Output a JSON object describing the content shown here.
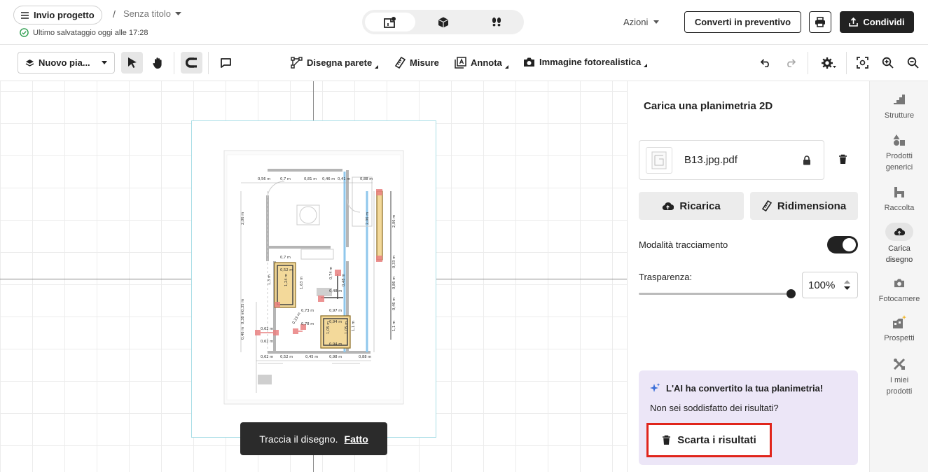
{
  "header": {
    "submit_label": "Invio progetto",
    "separator": "/",
    "project_title": "Senza titolo",
    "save_status": "Ultimo salvataggio oggi alle 17:28",
    "actions_label": "Azioni",
    "convert_label": "Converti in preventivo",
    "share_label": "Condividi"
  },
  "toolbar": {
    "level_label": "Nuovo pia...",
    "draw_wall": "Disegna parete",
    "measures": "Misure",
    "annotate": "Annota",
    "photo_image": "Immagine fotorealistica"
  },
  "canvas": {
    "toast_text": "Traccia il disegno.",
    "toast_done": "Fatto"
  },
  "panel": {
    "title": "Carica una planimetria 2D",
    "file_name": "B13.jpg.pdf",
    "reload_label": "Ricarica",
    "resize_label": "Ridimensiona",
    "tracing_label": "Modalità tracciamento",
    "tracing_on": true,
    "transparency_label": "Trasparenza:",
    "transparency_value": "100%",
    "ai_title": "L'AI ha convertito la tua planimetria!",
    "ai_question": "Non sei soddisfatto dei risultati?",
    "discard_label": "Scarta i risultati"
  },
  "rail": {
    "items": [
      {
        "label": "Strutture",
        "icon": "stairs-icon"
      },
      {
        "label": "Prodotti generici",
        "icon": "shapes-icon"
      },
      {
        "label": "Raccolta",
        "icon": "collection-icon"
      },
      {
        "label": "Carica disegno",
        "icon": "cloud-upload-icon"
      },
      {
        "label": "Fotocamere",
        "icon": "camera-icon"
      },
      {
        "label": "Prospetti",
        "icon": "elevation-icon"
      },
      {
        "label": "I miei prodotti",
        "icon": "tools-icon"
      }
    ]
  },
  "plan": {
    "dimensions": [
      "0,56 m",
      "0,7 m",
      "0,81 m",
      "0,46 m",
      "0,41 m",
      "0,88 m",
      "2,06 m",
      "2,06 m",
      "2,06 m",
      "0,7 m",
      "0,52 m",
      "1,3 m",
      "1,24 m",
      "1,63 m",
      "0,48 m",
      "0,74 m",
      "0,48 m",
      "0,73 m",
      "0,97 m",
      "0,62 m",
      "0,78 m",
      "0,33 m",
      "0,94 m",
      "1,05 m",
      "1,05 m",
      "0,94 m",
      "0,62 m",
      "0,62 m",
      "0,52 m",
      "0,45 m",
      "0,98 m",
      "0,88 m",
      "0,33 m",
      "0,86 m",
      "0,46 m",
      "1,1 m",
      "1,1 m",
      "0,35 m",
      "0,38 m",
      "0,46 m"
    ]
  },
  "colors": {
    "accent_dark": "#222222",
    "highlight_red": "#e0251b",
    "ai_bg": "#ece6f7",
    "guide_cyan": "#a8dde6"
  }
}
